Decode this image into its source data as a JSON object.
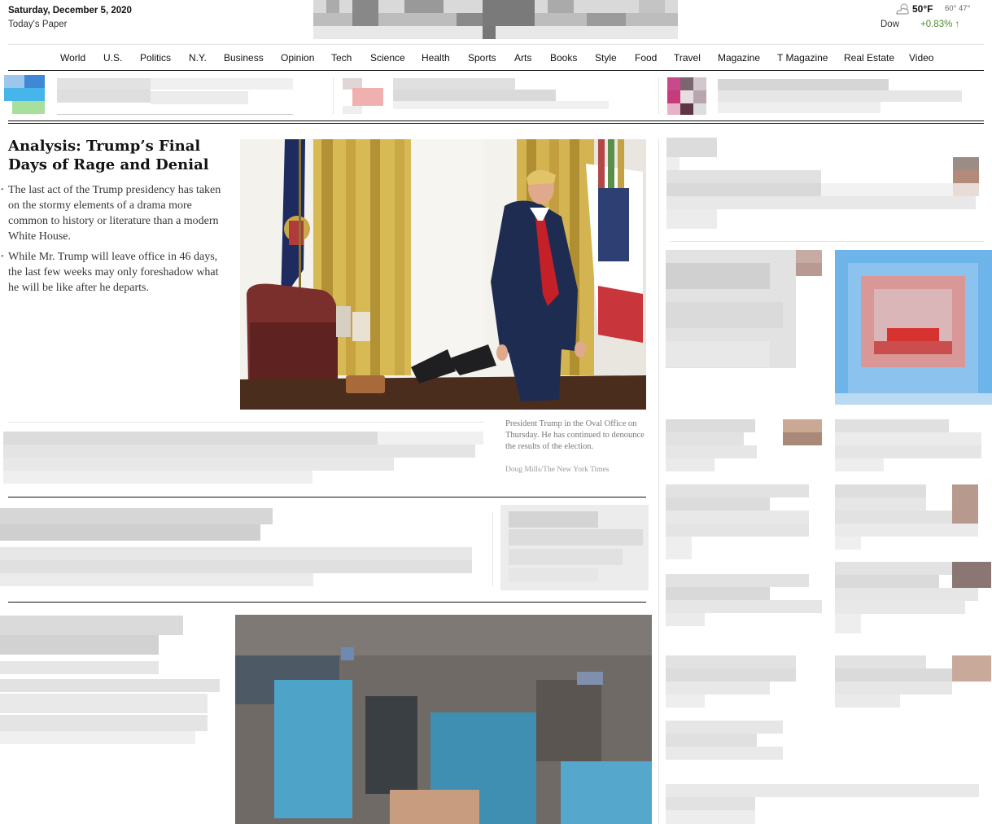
{
  "masthead": {
    "date": "Saturday, December 5, 2020",
    "todays_paper": "Today's Paper"
  },
  "weather": {
    "icon": "cloud-sun-icon",
    "temp": "50°F",
    "hi_lo": "60° 47°",
    "market_label": "Dow",
    "market_change": "+0.83%",
    "market_arrow": "↑",
    "market_color": "#4b8d34"
  },
  "nav": {
    "items": [
      "World",
      "U.S.",
      "Politics",
      "N.Y.",
      "Business",
      "Opinion",
      "Tech",
      "Science",
      "Health",
      "Sports",
      "Arts",
      "Books",
      "Style",
      "Food",
      "Travel",
      "Magazine",
      "T Magazine",
      "Real Estate",
      "Video"
    ]
  },
  "lead": {
    "headline": "Analysis: Trump’s Final Days of Rage and Denial",
    "bullets": [
      "The last act of the Trump presidency has taken on the stormy elements of a drama more common to history or literature than a modern White House.",
      "While Mr. Trump will leave office in 46 days, the last few weeks may only foreshadow what he will be like after he departs."
    ],
    "caption": "President Trump in the Oval Office on Thursday. He has continued to denounce the results of the election.",
    "credit": "Doug Mills/The New York Times"
  }
}
